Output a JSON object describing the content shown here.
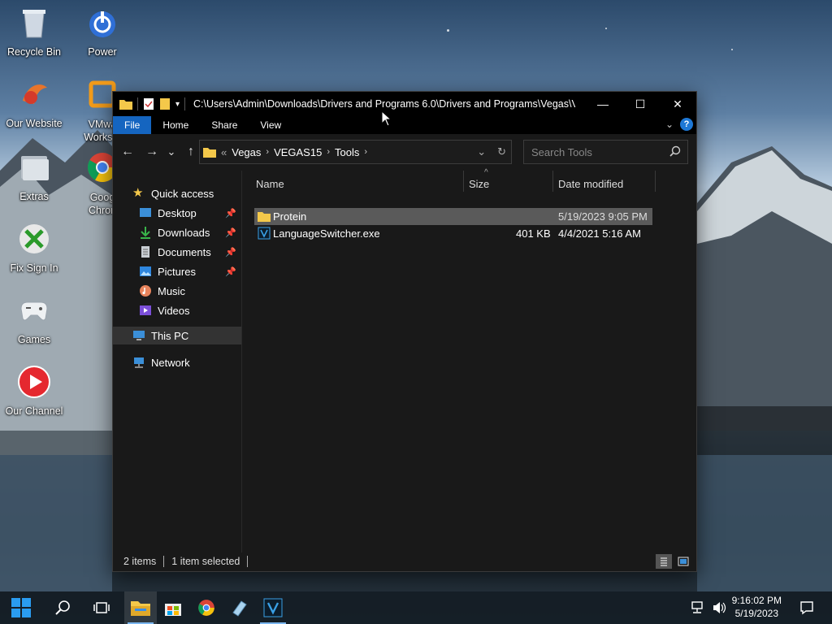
{
  "desktop": {
    "icons": [
      {
        "label": "Recycle Bin",
        "icon": "recycle-bin-icon"
      },
      {
        "label": "Power",
        "icon": "power-icon"
      },
      {
        "label": "Our Website",
        "icon": "website-icon"
      },
      {
        "label": "VMwa\nWorksta",
        "icon": "vmware-icon"
      },
      {
        "label": "Extras",
        "icon": "folder-stack-icon"
      },
      {
        "label": "Goog\nChron",
        "icon": "chrome-icon"
      },
      {
        "label": "Fix Sign In",
        "icon": "xbox-icon"
      },
      {
        "label": "Games",
        "icon": "gamepad-icon"
      },
      {
        "label": "Our Channel",
        "icon": "youtube-play-icon"
      }
    ]
  },
  "window": {
    "title": "C:\\Users\\Admin\\Downloads\\Drivers and Programs 6.0\\Drivers and Programs\\Vegas\\V...",
    "controls": {
      "minimize": "—",
      "maximize": "☐",
      "close": "✕"
    }
  },
  "ribbon": {
    "tabs": [
      "File",
      "Home",
      "Share",
      "View"
    ]
  },
  "nav": {
    "back": "←",
    "forward": "→",
    "recent": "⌄",
    "up": "↑"
  },
  "address": {
    "overflow": "«",
    "crumbs": [
      "Vegas",
      "VEGAS15",
      "Tools"
    ]
  },
  "search": {
    "placeholder": "Search Tools"
  },
  "navpane": {
    "quick_access": "Quick access",
    "items": [
      {
        "label": "Desktop",
        "pinned": true
      },
      {
        "label": "Downloads",
        "pinned": true
      },
      {
        "label": "Documents",
        "pinned": true
      },
      {
        "label": "Pictures",
        "pinned": true
      },
      {
        "label": "Music",
        "pinned": false
      },
      {
        "label": "Videos",
        "pinned": false
      }
    ],
    "this_pc": "This PC",
    "network": "Network"
  },
  "columns": {
    "name": "Name",
    "size": "Size",
    "date": "Date modified"
  },
  "files": [
    {
      "name": "Protein",
      "size": "",
      "date": "5/19/2023 9:05 PM",
      "type": "folder",
      "selected": true
    },
    {
      "name": "LanguageSwitcher.exe",
      "size": "401 KB",
      "date": "4/4/2021 5:16 AM",
      "type": "exe",
      "selected": false
    }
  ],
  "status": {
    "count": "2 items",
    "selection": "1 item selected"
  },
  "taskbar": {
    "time": "9:16:02 PM",
    "date": "5/19/2023"
  },
  "colors": {
    "accent": "#1565c0",
    "folder": "#f4c84a",
    "window_bg": "#191919"
  }
}
